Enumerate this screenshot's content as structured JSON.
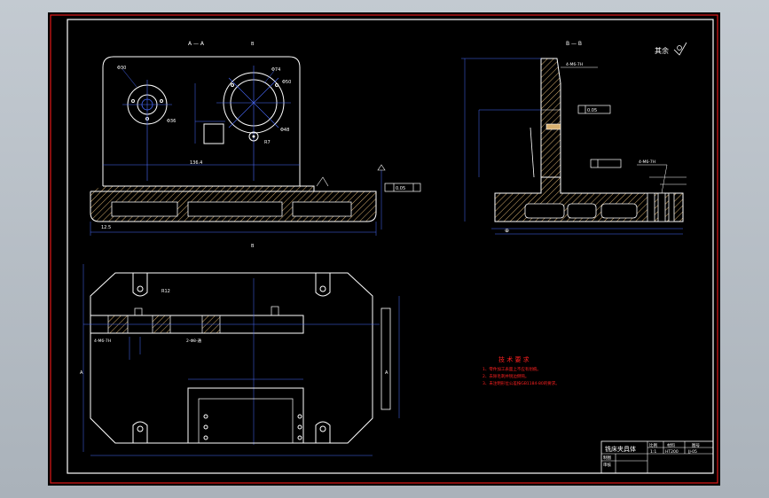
{
  "drawing": {
    "section_a_label": "A — A",
    "section_b_label": "B — B",
    "marker_b": "B",
    "marker_a": "A",
    "roughness_note": "其余",
    "tech_req": {
      "title": "技 术 要 求",
      "items": [
        "1、零件加工表面上不应有划痕。",
        "2、去除毛刺并锐边倒钝。",
        "3、未注明形位公差按GB1184-80的要求。"
      ]
    },
    "dims": {
      "bore1": "Φ30",
      "bore2": "Φ36",
      "bore3": "Φ74",
      "bore4": "Φ50",
      "bore5": "Φ48",
      "r7": "R7",
      "width": "136.4",
      "thick": "12.5",
      "flat1": "0.05",
      "flat2": "0.05",
      "thread": "4-M6-7H",
      "r12": "R12",
      "hole": "2-Φ8-通"
    },
    "title_block": {
      "name": "铣床夹具体",
      "col1": "比例",
      "col2": "材料",
      "col3": "图号",
      "scale": "1:1",
      "code": "HT200",
      "dwg_no": "JJ-05",
      "row1": "制图",
      "row2": "审核"
    }
  },
  "colors": {
    "background": "#000000",
    "line": "#ffffff",
    "dim": "#4a6cff",
    "hatch": "#d8b070",
    "frame_outer": "#e01818",
    "text_red": "#ff2020"
  }
}
